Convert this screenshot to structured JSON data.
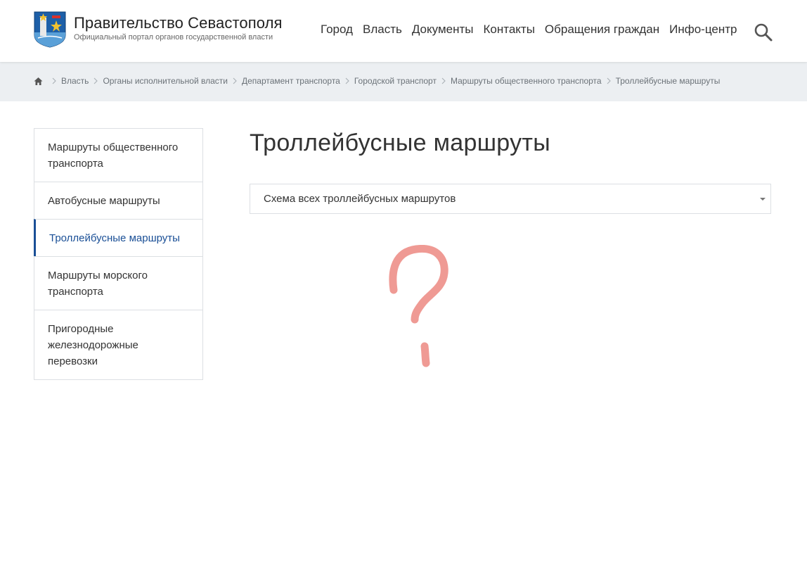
{
  "brand": {
    "title": "Правительство Севастополя",
    "subtitle": "Официальный портал органов государственной власти"
  },
  "nav": {
    "items": [
      "Город",
      "Власть",
      "Документы",
      "Контакты",
      "Обращения граждан",
      "Инфо-центр"
    ]
  },
  "breadcrumbs": [
    "Власть",
    "Органы исполнительной власти",
    "Департамент транспорта",
    "Городской транспорт",
    "Маршруты общественного транспорта",
    "Троллейбусные маршруты"
  ],
  "sidebar": {
    "items": [
      {
        "label": "Маршруты общественного транспорта",
        "active": false
      },
      {
        "label": "Автобусные маршруты",
        "active": false
      },
      {
        "label": "Троллейбусные маршруты",
        "active": true
      },
      {
        "label": "Маршруты морского транспорта",
        "active": false
      },
      {
        "label": "Пригородные железнодорожные перевозки",
        "active": false
      }
    ]
  },
  "main": {
    "title": "Троллейбусные маршруты",
    "select_value": "Схема всех троллейбусных маршрутов"
  },
  "icons": {
    "logo": "sevastopol-coat-of-arms-icon",
    "search": "search-icon",
    "home": "home-icon",
    "separator": "chevron-right-icon",
    "caret": "caret-down-icon",
    "overlay": "question-mark-drawing"
  },
  "colors": {
    "accent": "#1a4f96",
    "breadcrumb_bg": "#eceff2",
    "overlay": "#ef9a94"
  }
}
